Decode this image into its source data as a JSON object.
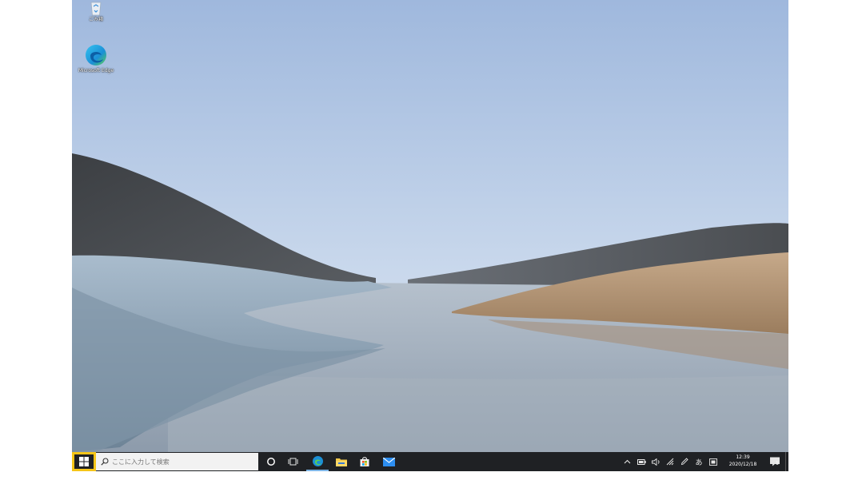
{
  "desktop": {
    "icons": [
      {
        "label": "ごみ箱",
        "icon": "recycle-bin-icon"
      },
      {
        "label": "Microsoft Edge",
        "icon": "edge-icon"
      }
    ]
  },
  "taskbar": {
    "start": {
      "icon": "windows-logo-icon",
      "highlight_color": "#f5c518"
    },
    "search": {
      "placeholder": "ここに入力して検索",
      "icon": "search-icon"
    },
    "buttons": [
      {
        "name": "cortana",
        "icon": "cortana-circle-icon"
      },
      {
        "name": "task-view",
        "icon": "task-view-icon"
      },
      {
        "name": "edge",
        "icon": "edge-icon",
        "active": true
      },
      {
        "name": "file-explorer",
        "icon": "folder-icon"
      },
      {
        "name": "store",
        "icon": "store-bag-icon"
      },
      {
        "name": "mail",
        "icon": "mail-icon"
      }
    ],
    "tray": {
      "ime": "あ",
      "clock": {
        "time": "12:39",
        "date": "2020/12/18"
      },
      "notifications_count": "1"
    },
    "background_color": "#1f2124",
    "accent_color": "#7fb5e6"
  }
}
